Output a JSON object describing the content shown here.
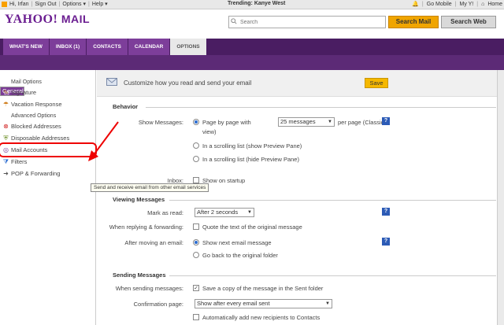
{
  "topbar": {
    "greeting": "Hi, Irfan",
    "sign_out": "Sign Out",
    "options": "Options ▾",
    "help": "Help ▾",
    "trending_label": "Trending: Kanye West",
    "go_mobile": "Go Mobile",
    "my_y": "My Y!",
    "home": "Home"
  },
  "header": {
    "logo": "YAHOO!",
    "logo_mail": "MAIL",
    "search_placeholder": "Search",
    "search_mail": "Search Mail",
    "search_web": "Search Web"
  },
  "tabs": [
    "WHAT'S NEW",
    "INBOX (1)",
    "CONTACTS",
    "CALENDAR",
    "OPTIONS"
  ],
  "sidebar": {
    "mail_options": "Mail Options",
    "general": "General",
    "signature": "Signature",
    "vacation": "Vacation Response",
    "advanced": "Advanced Options",
    "blocked": "Blocked Addresses",
    "disposable": "Disposable Addresses",
    "mail_accounts": "Mail Accounts",
    "filters": "Filters",
    "pop": "POP & Forwarding"
  },
  "tooltip": "Send and receive email from other email services",
  "main": {
    "header_text": "Customize how you read and send your email",
    "save": "Save",
    "behavior": "Behavior",
    "show_messages": "Show Messages:",
    "page_by_page_a": "Page by page with",
    "messages_count": "25 messages",
    "page_by_page_b": "per page (Classic",
    "page_by_page_c": "view)",
    "scroll_preview": "In a scrolling list (show Preview Pane)",
    "scroll_hide": "In a scrolling list (hide Preview Pane)",
    "inbox": "Inbox:",
    "show_startup": "Show on startup",
    "viewing": "Viewing Messages",
    "mark_as_read": "Mark as read:",
    "after_2": "After 2 seconds",
    "replying": "When replying & forwarding:",
    "quote": "Quote the text of the original message",
    "after_moving": "After moving an email:",
    "show_next": "Show next email message",
    "go_back": "Go back to the original folder",
    "sending": "Sending Messages",
    "when_sending": "When sending messages:",
    "save_copy": "Save a copy of the message in the Sent folder",
    "confirmation": "Confirmation page:",
    "show_after": "Show after every email sent",
    "auto_add": "Automatically add new recipients to Contacts",
    "help": "?"
  },
  "colors": {
    "brand_purple": "#4a1d62",
    "accent_orange": "#f0a500",
    "selected": "#7b3b96"
  }
}
